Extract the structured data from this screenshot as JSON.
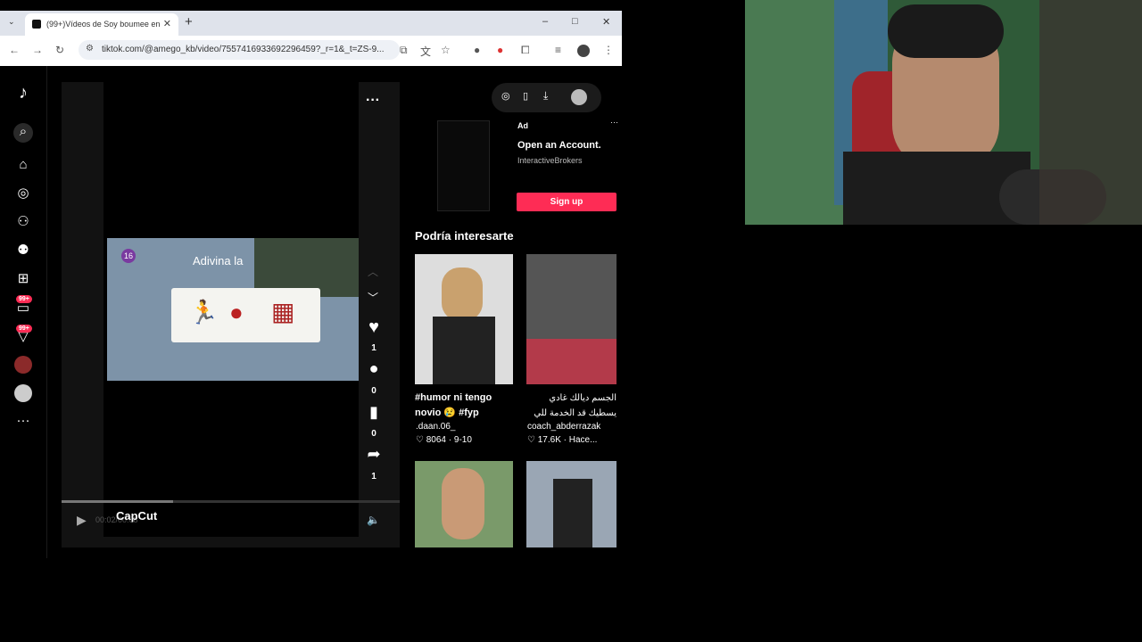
{
  "browser": {
    "tab_title": "(99+)Vídeos de Soy boumee en",
    "new_tab": "+",
    "url": "tiktok.com/@amego_kb/video/7557416933692296459?_r=1&_t=ZS-9...",
    "win_min": "–",
    "win_max": "□",
    "win_close": "✕"
  },
  "sidebar": {
    "badge_inbox": "99+",
    "badge_activity": "99+",
    "more": "···"
  },
  "video": {
    "overlay_text": "Adivina la",
    "badge_num": "16",
    "likes": "1",
    "comments": "0",
    "saves": "0",
    "shares": "1",
    "watermark": "CapCut",
    "time": "00:02/00:08",
    "more": "···"
  },
  "ad": {
    "label": "Ad",
    "title": "Open an Account.",
    "brand": "InteractiveBrokers",
    "cta": "Sign up",
    "more": "···"
  },
  "suggestions": {
    "heading": "Podría interesarte",
    "items": [
      {
        "title": "#humor ni tengo novio 😢 #fyp",
        "author": ".daan.06_",
        "stats": "♡ 8064 · 9-10"
      },
      {
        "title": "الجسم ديالك غادي يسطيك قد الخدمة للي درتي فيه، ماشي",
        "author": "coach_abderrazak",
        "stats": "♡ 17.6K · Hace..."
      }
    ]
  },
  "colors": {
    "accent": "#fe2c55",
    "tiktok_bg": "#000000"
  }
}
